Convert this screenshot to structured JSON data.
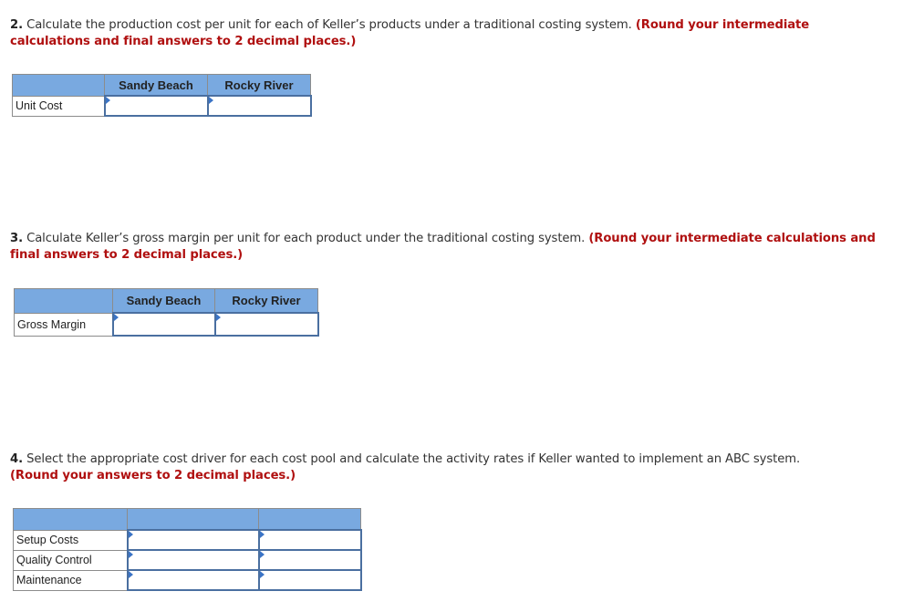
{
  "questions": [
    {
      "number": "2.",
      "text": " Calculate the production cost per unit for each of Keller’s products under a traditional costing system. ",
      "instruction": "(Round your intermediate calculations and final answers to 2 decimal places.)",
      "table": {
        "headers": [
          "",
          "Sandy Beach",
          "Rocky River"
        ],
        "rows": [
          {
            "label": "Unit Cost",
            "values": [
              "",
              ""
            ]
          }
        ]
      }
    },
    {
      "number": "3.",
      "text": " Calculate Keller’s gross margin per unit for each product under the traditional costing system. ",
      "instruction": "(Round your intermediate calculations and final answers to 2 decimal places.)",
      "table": {
        "headers": [
          "",
          "Sandy Beach",
          "Rocky River"
        ],
        "rows": [
          {
            "label": "Gross Margin",
            "values": [
              "",
              ""
            ]
          }
        ]
      }
    },
    {
      "number": "4.",
      "text": " Select the appropriate cost driver for each cost pool and calculate the activity rates if Keller wanted to implement an ABC system. ",
      "instruction": "(Round your answers to 2 decimal places.)",
      "table": {
        "headers": [
          "",
          "",
          ""
        ],
        "rows": [
          {
            "label": "Setup Costs",
            "values": [
              "",
              ""
            ]
          },
          {
            "label": "Quality Control",
            "values": [
              "",
              ""
            ]
          },
          {
            "label": "Maintenance",
            "values": [
              "",
              ""
            ]
          }
        ]
      }
    }
  ],
  "colors": {
    "header_fill": "#79a9e0",
    "instruction_red": "#b01010",
    "input_border": "#4a6fa0"
  }
}
